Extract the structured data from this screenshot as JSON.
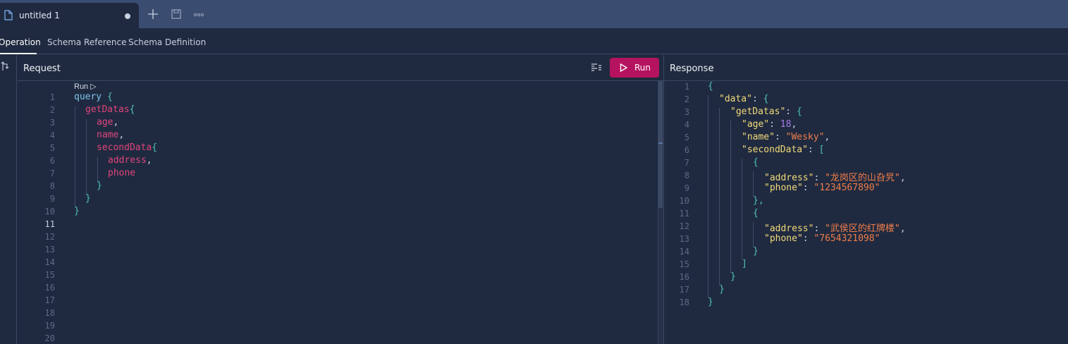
{
  "tabs": {
    "document_title": "untitled 1"
  },
  "subtabs": [
    "Operation",
    "Schema Reference",
    "Schema Definition"
  ],
  "request": {
    "title": "Request",
    "run_label": "Run",
    "run_lens": "Run ▷",
    "line_numbers": [
      "1",
      "2",
      "3",
      "4",
      "5",
      "6",
      "7",
      "8",
      "9",
      "10",
      "11",
      "12",
      "13",
      "14",
      "15",
      "16",
      "17",
      "18",
      "19",
      "20"
    ],
    "code": {
      "kw_query": "query",
      "brace_open": "{",
      "brace_close": "}",
      "get_datas": "getDatas",
      "age": "age",
      "name": "name",
      "second_data": "secondData",
      "address": "address",
      "phone": "phone",
      "comma": ","
    }
  },
  "response": {
    "title": "Response",
    "line_numbers": [
      "1",
      "2",
      "3",
      "4",
      "5",
      "6",
      "7",
      "8",
      "9",
      "10",
      "11",
      "12",
      "13",
      "14",
      "15",
      "16",
      "17",
      "18"
    ],
    "tokens": {
      "k_data": "\"data\"",
      "k_get_datas": "\"getDatas\"",
      "k_age": "\"age\"",
      "v_age": "18",
      "k_name": "\"name\"",
      "v_name": "\"Wesky\"",
      "k_second_data": "\"secondData\"",
      "k_address": "\"address\"",
      "v_address_1": "\"龙岗区的山旮旯\"",
      "k_phone": "\"phone\"",
      "v_phone_1": "\"1234567890\"",
      "v_address_2": "\"武侯区的红牌楼\"",
      "v_phone_2": "\"7654321098\"",
      "colon": ": ",
      "comma": ",",
      "brace_open": "{",
      "brace_close": "}",
      "bracket_open": "[",
      "bracket_close": "]",
      "brace_close_comma": "},"
    }
  },
  "colors": {
    "accent_run": "#b5135f",
    "keyword": "#7cc4e8",
    "field": "#e0457b",
    "json_key": "#f2d978",
    "json_string": "#f07c49",
    "json_number": "#a87ce8"
  },
  "icons": [
    "file-icon",
    "plus-icon",
    "save-icon",
    "more-icon",
    "merge-icon",
    "prettify-icon",
    "play-icon"
  ]
}
